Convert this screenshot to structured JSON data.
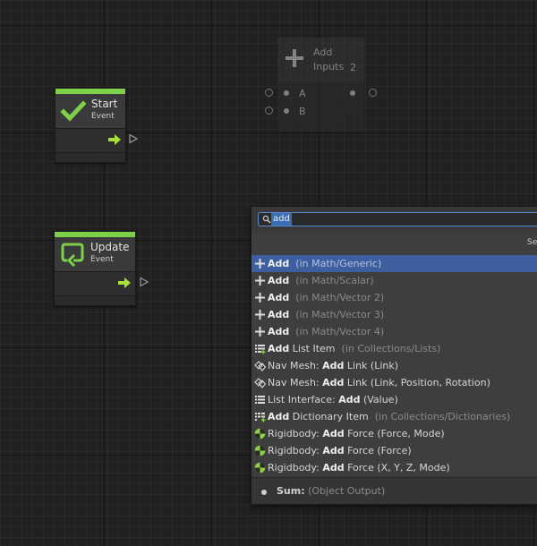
{
  "colors": {
    "event_accent": "#7ed04a",
    "flow_arrow": "#a6e23a",
    "selection": "#3d5fa0",
    "search_border": "#5a8cd6"
  },
  "nodes": {
    "start": {
      "title": "Start",
      "subtitle": "Event",
      "icon": "checkmark-icon"
    },
    "update": {
      "title": "Update",
      "subtitle": "Event",
      "icon": "loop-icon"
    },
    "add": {
      "title_line1": "Add",
      "title_line2": "Inputs",
      "inputs_count": "2",
      "input_a": "A",
      "input_b": "B",
      "icon": "plus-icon"
    }
  },
  "finder": {
    "search_value": "add",
    "header_truncated": "Se",
    "items": [
      {
        "prefix": "",
        "bold": "Add",
        "suffix": "",
        "context": "(in Math/Generic)",
        "icon": "plus-icon",
        "selected": true
      },
      {
        "prefix": "",
        "bold": "Add",
        "suffix": "",
        "context": "(in Math/Scalar)",
        "icon": "plus-icon"
      },
      {
        "prefix": "",
        "bold": "Add",
        "suffix": "",
        "context": "(in Math/Vector 2)",
        "icon": "plus-icon"
      },
      {
        "prefix": "",
        "bold": "Add",
        "suffix": "",
        "context": "(in Math/Vector 3)",
        "icon": "plus-icon"
      },
      {
        "prefix": "",
        "bold": "Add",
        "suffix": "",
        "context": "(in Math/Vector 4)",
        "icon": "plus-icon"
      },
      {
        "prefix": "",
        "bold": "Add",
        "suffix": " List Item",
        "context": "(in Collections/Lists)",
        "icon": "list-add-icon"
      },
      {
        "prefix": "Nav Mesh: ",
        "bold": "Add",
        "suffix": " Link (Link)",
        "context": "",
        "icon": "nav-mesh-icon"
      },
      {
        "prefix": "Nav Mesh: ",
        "bold": "Add",
        "suffix": " Link (Link, Position, Rotation)",
        "context": "",
        "icon": "nav-mesh-icon"
      },
      {
        "prefix": "List Interface: ",
        "bold": "Add",
        "suffix": " (Value)",
        "context": "",
        "icon": "list-icon"
      },
      {
        "prefix": "",
        "bold": "Add",
        "suffix": " Dictionary Item",
        "context": "(in Collections/Dictionaries)",
        "icon": "dictionary-add-icon"
      },
      {
        "prefix": "Rigidbody: ",
        "bold": "Add",
        "suffix": " Force (Force, Mode)",
        "context": "",
        "icon": "rigidbody-icon"
      },
      {
        "prefix": "Rigidbody: ",
        "bold": "Add",
        "suffix": " Force (Force)",
        "context": "",
        "icon": "rigidbody-icon"
      },
      {
        "prefix": "Rigidbody: ",
        "bold": "Add",
        "suffix": " Force (X, Y, Z, Mode)",
        "context": "",
        "icon": "rigidbody-icon"
      }
    ],
    "footer": {
      "label": "Sum:",
      "context": "(Object Output)",
      "icon": "output-dot-icon"
    }
  }
}
